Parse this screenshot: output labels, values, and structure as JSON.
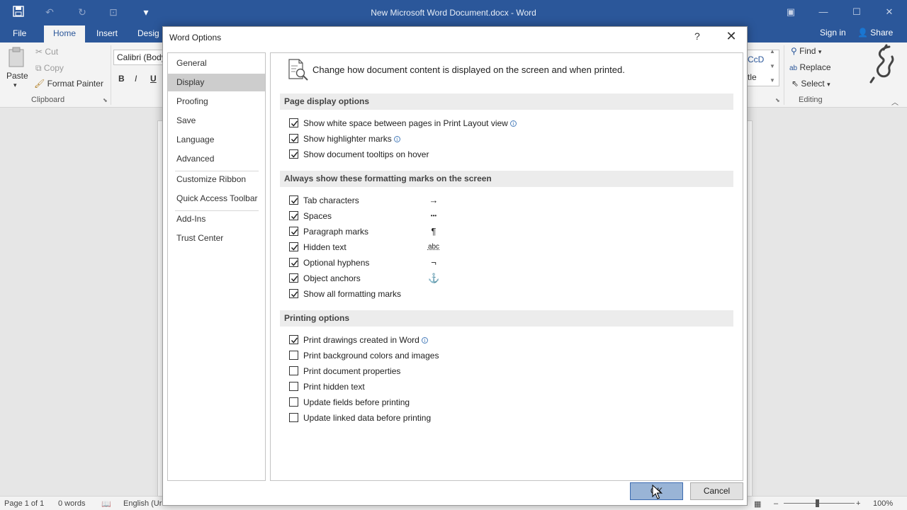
{
  "window": {
    "title": "New Microsoft Word Document.docx - Word",
    "qat_icons": [
      "save-icon",
      "undo-icon",
      "redo-icon",
      "touch-mode-icon",
      "customize-qat-icon"
    ],
    "controls": [
      "ribbon-display-icon",
      "minimize-icon",
      "maximize-icon",
      "close-icon"
    ]
  },
  "ribbon": {
    "tabs": [
      "File",
      "Home",
      "Insert",
      "Desig"
    ],
    "active_tab": "Home",
    "sign_in": "Sign in",
    "share": "Share",
    "clipboard": {
      "paste": "Paste",
      "cut": "Cut",
      "copy": "Copy",
      "format_painter": "Format Painter",
      "group_label": "Clipboard"
    },
    "font": {
      "name": "Calibri (Body",
      "bold": "B",
      "italic": "I",
      "underline": "U"
    },
    "styles": {
      "sample1": "CcD",
      "sample2": "tle"
    },
    "editing": {
      "find": "Find",
      "replace": "Replace",
      "select": "Select",
      "group_label": "Editing"
    }
  },
  "status": {
    "page": "Page 1 of 1",
    "words": "0 words",
    "language": "English (Ur",
    "zoom": "100%",
    "zoom_minus": "–",
    "zoom_plus": "+"
  },
  "dialog": {
    "title": "Word Options",
    "help": "?",
    "close": "✕",
    "nav": {
      "group1": [
        "General",
        "Display",
        "Proofing",
        "Save",
        "Language",
        "Advanced"
      ],
      "group2": [
        "Customize Ribbon",
        "Quick Access Toolbar"
      ],
      "group3": [
        "Add-Ins",
        "Trust Center"
      ],
      "selected": "Display"
    },
    "header": "Change how document content is displayed on the screen and when printed.",
    "sections": {
      "page_display": {
        "title": "Page display options",
        "options": [
          {
            "label": "Show white space between pages in Print Layout view",
            "checked": true,
            "info": true
          },
          {
            "label": "Show highlighter marks",
            "checked": true,
            "info": true
          },
          {
            "label": "Show document tooltips on hover",
            "checked": true,
            "info": false
          }
        ]
      },
      "formatting_marks": {
        "title": "Always show these formatting marks on the screen",
        "options": [
          {
            "label": "Tab characters",
            "checked": true,
            "mark": "→"
          },
          {
            "label": "Spaces",
            "checked": true,
            "mark": "•••"
          },
          {
            "label": "Paragraph marks",
            "checked": true,
            "mark": "¶"
          },
          {
            "label": "Hidden text",
            "checked": true,
            "mark": "abc"
          },
          {
            "label": "Optional hyphens",
            "checked": true,
            "mark": "¬"
          },
          {
            "label": "Object anchors",
            "checked": true,
            "mark": "⚓"
          },
          {
            "label": "Show all formatting marks",
            "checked": true,
            "mark": ""
          }
        ]
      },
      "printing": {
        "title": "Printing options",
        "options": [
          {
            "label": "Print drawings created in Word",
            "checked": true,
            "info": true
          },
          {
            "label": "Print background colors and images",
            "checked": false,
            "info": false
          },
          {
            "label": "Print document properties",
            "checked": false,
            "info": false
          },
          {
            "label": "Print hidden text",
            "checked": false,
            "info": false
          },
          {
            "label": "Update fields before printing",
            "checked": false,
            "info": false
          },
          {
            "label": "Update linked data before printing",
            "checked": false,
            "info": false
          }
        ]
      }
    },
    "buttons": {
      "ok": "OK",
      "cancel": "Cancel"
    }
  }
}
